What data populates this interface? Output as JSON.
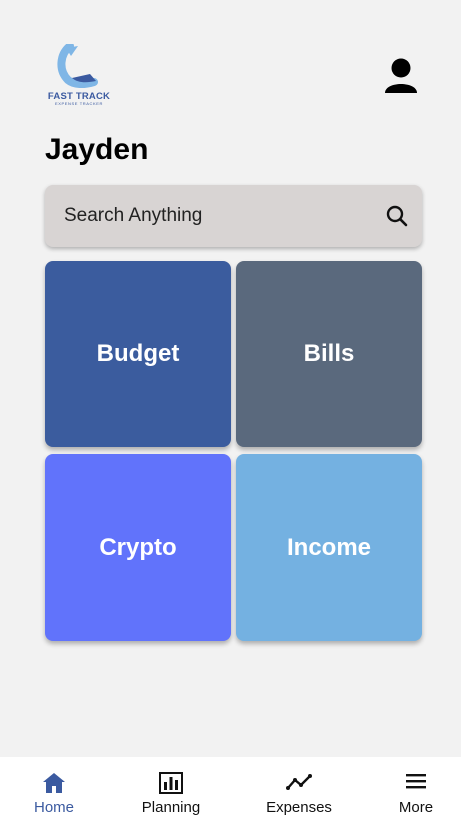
{
  "brand": {
    "title": "FAST TRACK",
    "subtitle": "EXPENSE TRACKER"
  },
  "user": {
    "name": "Jayden"
  },
  "search": {
    "placeholder": "Search Anything"
  },
  "tiles": [
    {
      "label": "Budget",
      "color": "#3b5c9e"
    },
    {
      "label": "Bills",
      "color": "#5a697d"
    },
    {
      "label": "Crypto",
      "color": "#6173fb"
    },
    {
      "label": "Income",
      "color": "#74b1e1"
    }
  ],
  "nav": [
    {
      "label": "Home",
      "icon": "home-icon",
      "active": true
    },
    {
      "label": "Planning",
      "icon": "bar-chart-icon"
    },
    {
      "label": "Expenses",
      "icon": "trend-line-icon"
    },
    {
      "label": "More",
      "icon": "menu-icon"
    }
  ],
  "colors": {
    "accent": "#3b5aa0",
    "background": "#f2f2f2",
    "search_bg": "#d8d4d3"
  }
}
